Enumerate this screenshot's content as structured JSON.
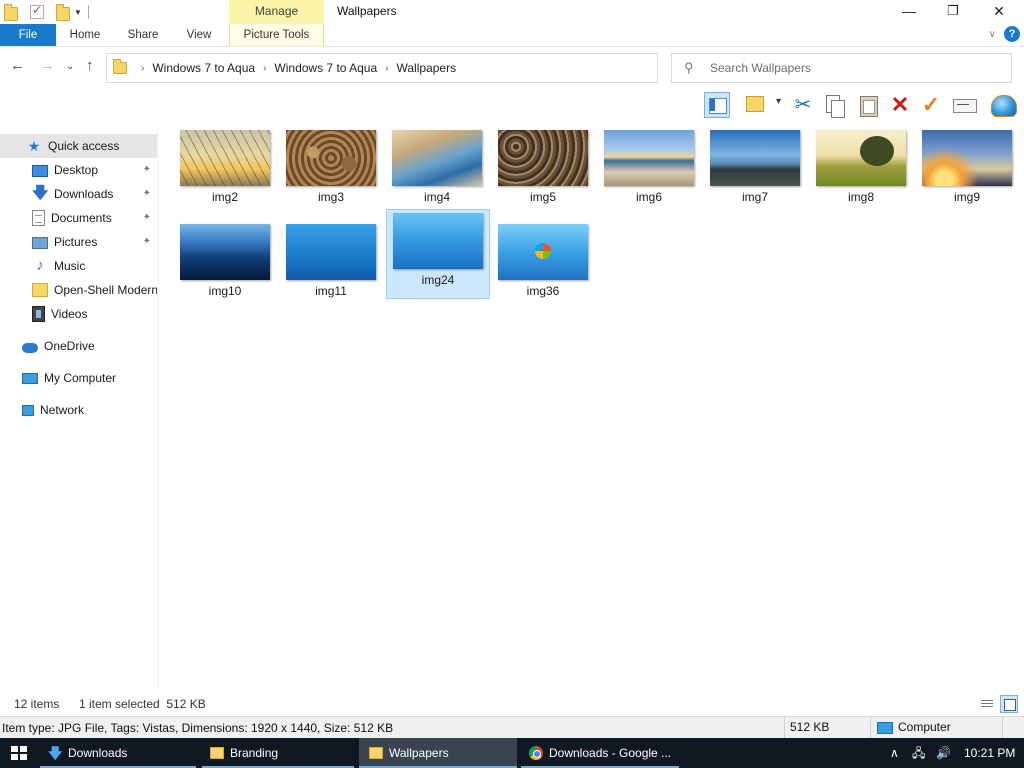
{
  "window": {
    "title": "Wallpapers",
    "contextual_group": "Manage",
    "controls": {
      "minimize": "—",
      "maximize": "❐",
      "close": "✕"
    }
  },
  "ribbon": {
    "tabs": [
      "File",
      "Home",
      "Share",
      "View",
      "Picture Tools"
    ],
    "expand_icon": "chevron-down-icon",
    "help": "?"
  },
  "address_bar": {
    "breadcrumbs": [
      "Windows 7 to Aqua",
      "Windows 7 to Aqua",
      "Wallpapers"
    ],
    "separator": "›",
    "dropdown": "⌄",
    "refresh": "↻"
  },
  "search": {
    "placeholder": "Search Wallpapers",
    "value": ""
  },
  "nav_buttons": {
    "back": "←",
    "forward": "→",
    "recent": "⌄",
    "up": "↑"
  },
  "sidebar": {
    "items": [
      {
        "label": "Quick access",
        "icon": "star-icon"
      },
      {
        "label": "Desktop",
        "icon": "desktop-icon",
        "pinned": true
      },
      {
        "label": "Downloads",
        "icon": "download-icon",
        "pinned": true
      },
      {
        "label": "Documents",
        "icon": "document-icon",
        "pinned": true
      },
      {
        "label": "Pictures",
        "icon": "pictures-icon",
        "pinned": true
      },
      {
        "label": "Music",
        "icon": "music-icon"
      },
      {
        "label": "Open-Shell Modern",
        "icon": "folder-icon"
      },
      {
        "label": "Videos",
        "icon": "video-icon"
      },
      {
        "label": "OneDrive",
        "icon": "cloud-icon"
      },
      {
        "label": "My Computer",
        "icon": "computer-icon"
      },
      {
        "label": "Network",
        "icon": "network-icon"
      }
    ],
    "pin_glyph": "📌"
  },
  "files": [
    {
      "name": "img2"
    },
    {
      "name": "img3"
    },
    {
      "name": "img4"
    },
    {
      "name": "img5"
    },
    {
      "name": "img6"
    },
    {
      "name": "img7"
    },
    {
      "name": "img8"
    },
    {
      "name": "img9"
    },
    {
      "name": "img10"
    },
    {
      "name": "img11"
    },
    {
      "name": "img24",
      "selected": true
    },
    {
      "name": "img36"
    }
  ],
  "status": {
    "item_count": "12 items",
    "selection": "1 item selected  512 KB",
    "details": "Item type: JPG File, Tags: Vistas, Dimensions: 1920 x 1440, Size: 512 KB",
    "size": "512 KB",
    "location": "Computer"
  },
  "taskbar": {
    "buttons": [
      {
        "label": "Downloads",
        "icon": "download-icon"
      },
      {
        "label": "Branding",
        "icon": "folder-icon"
      },
      {
        "label": "Wallpapers",
        "icon": "folder-icon",
        "active": true
      },
      {
        "label": "Downloads - Google ...",
        "icon": "chrome-icon"
      }
    ],
    "tray": {
      "chevron": "∧",
      "network": "🖧",
      "volume": "🔊",
      "time": "10:21 PM"
    }
  },
  "colors": {
    "accent": "#1979ca",
    "manage_tab": "#faf5a8",
    "selection": "#cce8ff",
    "taskbar": "#101822"
  }
}
